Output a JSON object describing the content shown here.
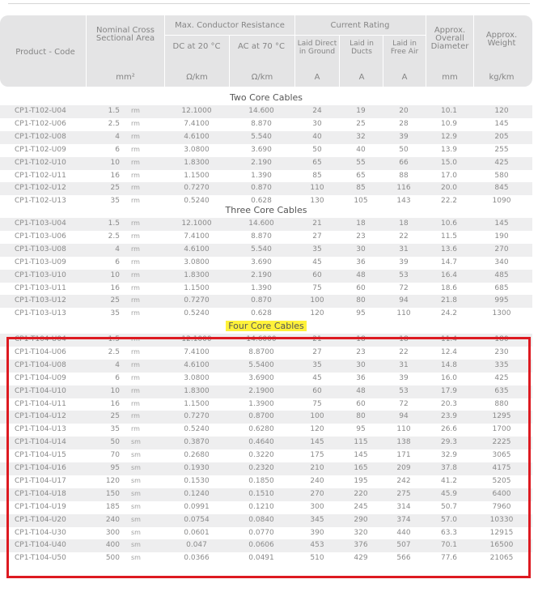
{
  "header": {
    "product_code": "Product - Code",
    "nominal_area": "Nominal Cross Sectional Area",
    "max_resistance": "Max. Conductor Resistance",
    "dc": "DC at 20 °C",
    "ac": "AC at 70 °C",
    "current_rating": "Current Rating",
    "laid_ground": "Laid Direct in Ground",
    "laid_ducts": "Laid in Ducts",
    "laid_air": "Laid in Free Air",
    "diameter": "Approx. Overall Diameter",
    "weight": "Approx. Weight"
  },
  "units": {
    "area": "mm²",
    "dc": "Ω/km",
    "ac": "Ω/km",
    "a1": "A",
    "a2": "A",
    "a3": "A",
    "dia": "mm",
    "wt": "kg/km"
  },
  "sections": [
    {
      "title": "Two Core Cables",
      "highlighted": false,
      "rows": [
        [
          "CP1-T102-U04",
          "1.5",
          "rm",
          "12.1000",
          "14.600",
          "24",
          "19",
          "20",
          "10.1",
          "120"
        ],
        [
          "CP1-T102-U06",
          "2.5",
          "rm",
          "7.4100",
          "8.870",
          "30",
          "25",
          "28",
          "10.9",
          "145"
        ],
        [
          "CP1-T102-U08",
          "4",
          "rm",
          "4.6100",
          "5.540",
          "40",
          "32",
          "39",
          "12.9",
          "205"
        ],
        [
          "CP1-T102-U09",
          "6",
          "rm",
          "3.0800",
          "3.690",
          "50",
          "40",
          "50",
          "13.9",
          "255"
        ],
        [
          "CP1-T102-U10",
          "10",
          "rm",
          "1.8300",
          "2.190",
          "65",
          "55",
          "66",
          "15.0",
          "425"
        ],
        [
          "CP1-T102-U11",
          "16",
          "rm",
          "1.1500",
          "1.390",
          "85",
          "65",
          "88",
          "17.0",
          "580"
        ],
        [
          "CP1-T102-U12",
          "25",
          "rm",
          "0.7270",
          "0.870",
          "110",
          "85",
          "116",
          "20.0",
          "845"
        ],
        [
          "CP1-T102-U13",
          "35",
          "rm",
          "0.5240",
          "0.628",
          "130",
          "105",
          "143",
          "22.2",
          "1090"
        ]
      ]
    },
    {
      "title": "Three Core Cables",
      "highlighted": false,
      "rows": [
        [
          "CP1-T103-U04",
          "1.5",
          "rm",
          "12.1000",
          "14.600",
          "21",
          "18",
          "18",
          "10.6",
          "145"
        ],
        [
          "CP1-T103-U06",
          "2.5",
          "rm",
          "7.4100",
          "8.870",
          "27",
          "23",
          "22",
          "11.5",
          "190"
        ],
        [
          "CP1-T103-U08",
          "4",
          "rm",
          "4.6100",
          "5.540",
          "35",
          "30",
          "31",
          "13.6",
          "270"
        ],
        [
          "CP1-T103-U09",
          "6",
          "rm",
          "3.0800",
          "3.690",
          "45",
          "36",
          "39",
          "14.7",
          "340"
        ],
        [
          "CP1-T103-U10",
          "10",
          "rm",
          "1.8300",
          "2.190",
          "60",
          "48",
          "53",
          "16.4",
          "485"
        ],
        [
          "CP1-T103-U11",
          "16",
          "rm",
          "1.1500",
          "1.390",
          "75",
          "60",
          "72",
          "18.6",
          "685"
        ],
        [
          "CP1-T103-U12",
          "25",
          "rm",
          "0.7270",
          "0.870",
          "100",
          "80",
          "94",
          "21.8",
          "995"
        ],
        [
          "CP1-T103-U13",
          "35",
          "rm",
          "0.5240",
          "0.628",
          "120",
          "95",
          "110",
          "24.2",
          "1300"
        ]
      ]
    },
    {
      "title": "Four Core Cables",
      "highlighted": true,
      "rows": [
        [
          "CP1-T104-U04",
          "1.5",
          "rm",
          "12.1000",
          "14.6000",
          "21",
          "18",
          "18",
          "11.4",
          "180"
        ],
        [
          "CP1-T104-U06",
          "2.5",
          "rm",
          "7.4100",
          "8.8700",
          "27",
          "23",
          "22",
          "12.4",
          "230"
        ],
        [
          "CP1-T104-U08",
          "4",
          "rm",
          "4.6100",
          "5.5400",
          "35",
          "30",
          "31",
          "14.8",
          "335"
        ],
        [
          "CP1-T104-U09",
          "6",
          "rm",
          "3.0800",
          "3.6900",
          "45",
          "36",
          "39",
          "16.0",
          "425"
        ],
        [
          "CP1-T104-U10",
          "10",
          "rm",
          "1.8300",
          "2.1900",
          "60",
          "48",
          "53",
          "17.9",
          "635"
        ],
        [
          "CP1-T104-U11",
          "16",
          "rm",
          "1.1500",
          "1.3900",
          "75",
          "60",
          "72",
          "20.3",
          "880"
        ],
        [
          "CP1-T104-U12",
          "25",
          "rm",
          "0.7270",
          "0.8700",
          "100",
          "80",
          "94",
          "23.9",
          "1295"
        ],
        [
          "CP1-T104-U13",
          "35",
          "rm",
          "0.5240",
          "0.6280",
          "120",
          "95",
          "110",
          "26.6",
          "1700"
        ],
        [
          "CP1-T104-U14",
          "50",
          "sm",
          "0.3870",
          "0.4640",
          "145",
          "115",
          "138",
          "29.3",
          "2225"
        ],
        [
          "CP1-T104-U15",
          "70",
          "sm",
          "0.2680",
          "0.3220",
          "175",
          "145",
          "171",
          "32.9",
          "3065"
        ],
        [
          "CP1-T104-U16",
          "95",
          "sm",
          "0.1930",
          "0.2320",
          "210",
          "165",
          "209",
          "37.8",
          "4175"
        ],
        [
          "CP1-T104-U17",
          "120",
          "sm",
          "0.1530",
          "0.1850",
          "240",
          "195",
          "242",
          "41.2",
          "5205"
        ],
        [
          "CP1-T104-U18",
          "150",
          "sm",
          "0.1240",
          "0.1510",
          "270",
          "220",
          "275",
          "45.9",
          "6400"
        ],
        [
          "CP1-T104-U19",
          "185",
          "sm",
          "0.0991",
          "0.1210",
          "300",
          "245",
          "314",
          "50.7",
          "7960"
        ],
        [
          "CP1-T104-U20",
          "240",
          "sm",
          "0.0754",
          "0.0840",
          "345",
          "290",
          "374",
          "57.0",
          "10330"
        ],
        [
          "CP1-T104-U30",
          "300",
          "sm",
          "0.0601",
          "0.0770",
          "390",
          "320",
          "440",
          "63.3",
          "12915"
        ],
        [
          "CP1-T104-U40",
          "400",
          "sm",
          "0.047",
          "0.0606",
          "453",
          "376",
          "507",
          "70.1",
          "16500"
        ],
        [
          "CP1-T104-U50",
          "500",
          "sm",
          "0.0366",
          "0.0491",
          "510",
          "429",
          "566",
          "77.6",
          "21065"
        ]
      ]
    }
  ]
}
